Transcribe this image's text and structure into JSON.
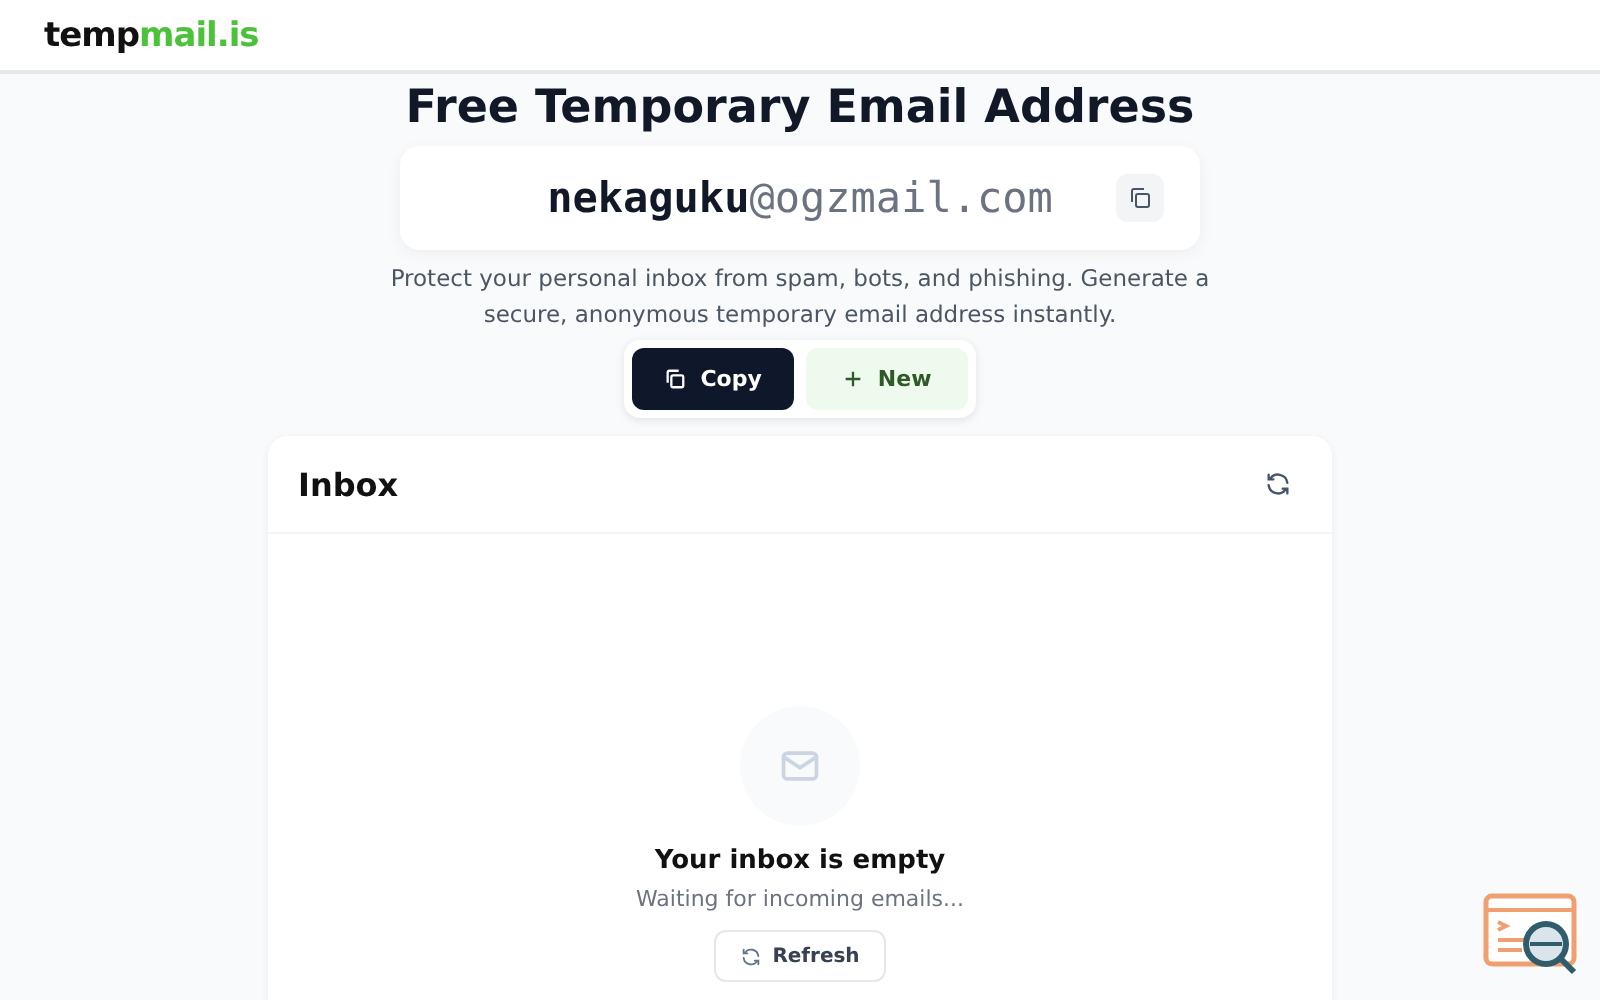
{
  "logo": {
    "part_1": "temp",
    "part_2": "mail.is"
  },
  "title": "Free Temporary Email Address",
  "email": {
    "user": "nekaguku",
    "domain": "@ogzmail.com"
  },
  "description": "Protect your personal inbox from spam, bots, and phishing. Generate a secure, anonymous temporary email address instantly.",
  "actions": [
    {
      "label": "Copy",
      "kind": "copy"
    },
    {
      "label": "New",
      "kind": "new"
    }
  ],
  "inbox": {
    "title": "Inbox",
    "empty_title": "Your inbox is empty",
    "empty_text": "Waiting for incoming emails...",
    "refresh_label": "Refresh"
  }
}
